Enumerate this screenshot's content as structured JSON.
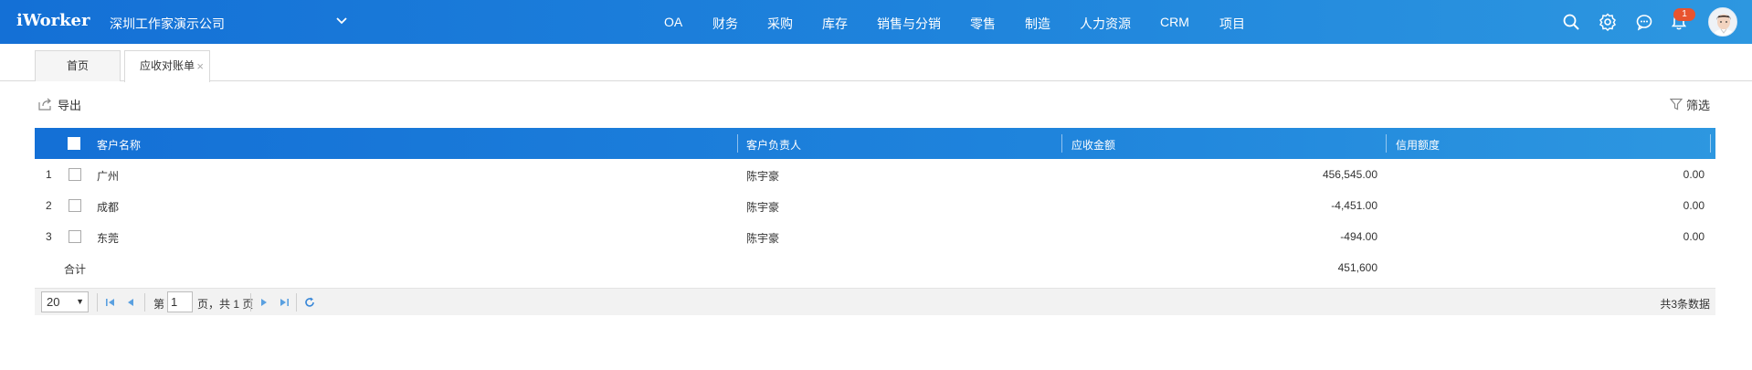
{
  "app": {
    "logo": "iWorker",
    "company": "深圳工作家演示公司"
  },
  "nav": [
    "OA",
    "财务",
    "采购",
    "库存",
    "销售与分销",
    "零售",
    "制造",
    "人力资源",
    "CRM",
    "项目"
  ],
  "notifications": {
    "count": "1"
  },
  "tabs": [
    {
      "label": "首页"
    },
    {
      "label": "应收对账单"
    }
  ],
  "toolbar": {
    "export_label": "导出",
    "filter_label": "筛选"
  },
  "table": {
    "columns": [
      "客户名称",
      "客户负责人",
      "应收金额",
      "信用额度"
    ],
    "rows": [
      {
        "index": "1",
        "customer": "广州",
        "owner": "陈宇豪",
        "receivable": "456,545.00",
        "credit": "0.00"
      },
      {
        "index": "2",
        "customer": "成都",
        "owner": "陈宇豪",
        "receivable": "-4,451.00",
        "credit": "0.00"
      },
      {
        "index": "3",
        "customer": "东莞",
        "owner": "陈宇豪",
        "receivable": "-494.00",
        "credit": "0.00"
      }
    ],
    "summary": {
      "label": "合计",
      "receivable": "451,600"
    }
  },
  "pager": {
    "page_size": "20",
    "page_prefix": "第",
    "current_page": "1",
    "page_suffix": "页，共 1 页",
    "total": "共3条数据"
  },
  "colors": {
    "header_blue": "#1470d6",
    "badge_red": "#e8542f"
  }
}
